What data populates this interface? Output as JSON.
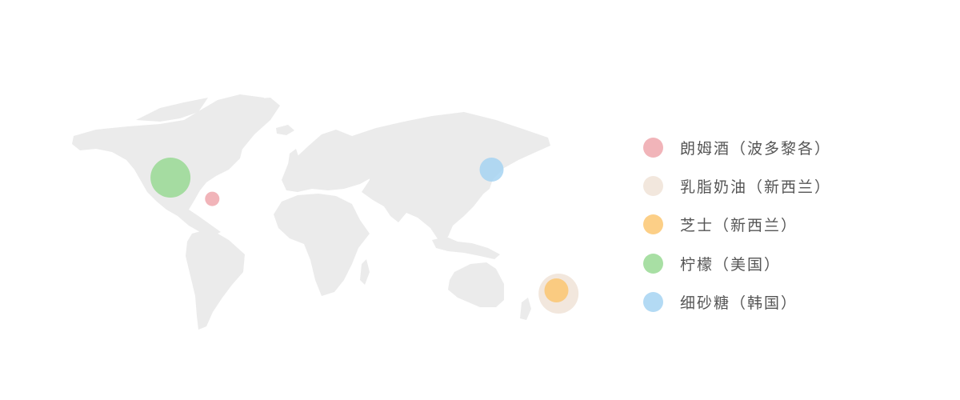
{
  "map": {
    "land_color": "#ebebeb",
    "markers": [
      {
        "name": "朗姆酒",
        "origin": "波多黎各",
        "color": "#eea3a9",
        "lon": -66.5,
        "lat": 18.2,
        "size": "small"
      },
      {
        "name": "乳脂奶油",
        "origin": "新西兰",
        "color": "#efe2d6",
        "lon": 174,
        "lat": -41,
        "size": "large"
      },
      {
        "name": "芝士",
        "origin": "新西兰",
        "color": "#fbc46c",
        "lon": 172.5,
        "lat": -39,
        "size": "medium"
      },
      {
        "name": "柠檬",
        "origin": "美国",
        "color": "#95d890",
        "lon": -95.5,
        "lat": 31.5,
        "size": "large"
      },
      {
        "name": "细砂糖",
        "origin": "韩国",
        "color": "#a2d2f1",
        "lon": 127.5,
        "lat": 36.5,
        "size": "medium"
      }
    ]
  },
  "legend": {
    "items": [
      {
        "label": "朗姆酒（波多黎各）",
        "color": "#eea3a9"
      },
      {
        "label": "乳脂奶油（新西兰）",
        "color": "#efe2d6"
      },
      {
        "label": "芝士（新西兰）",
        "color": "#fbc46c"
      },
      {
        "label": "柠檬（美国）",
        "color": "#95d890"
      },
      {
        "label": "细砂糖（韩国）",
        "color": "#a2d2f1"
      }
    ]
  }
}
